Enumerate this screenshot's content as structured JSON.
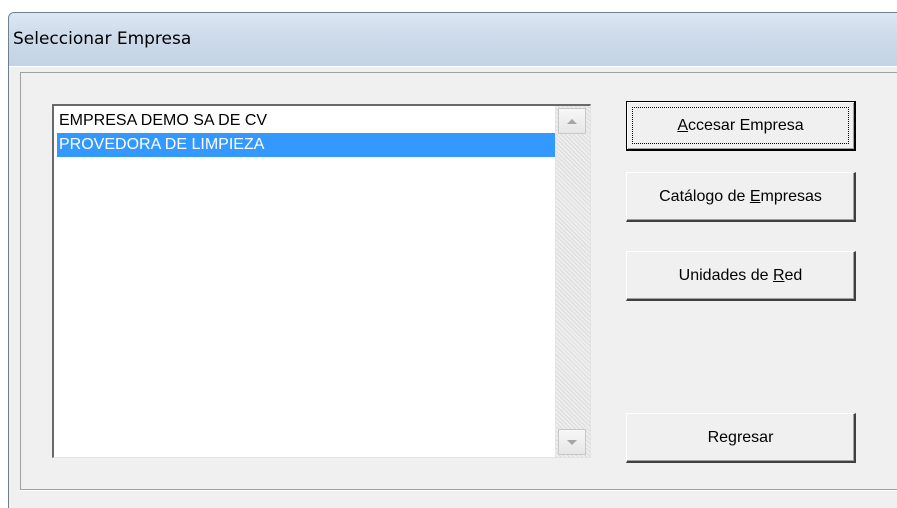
{
  "window": {
    "title": "Seleccionar Empresa"
  },
  "company_list": {
    "items": [
      {
        "label": "EMPRESA DEMO SA DE CV",
        "selected": false
      },
      {
        "label": "PROVEDORA DE LIMPIEZA",
        "selected": true
      }
    ]
  },
  "buttons": {
    "accesar": {
      "pre": "",
      "accel": "A",
      "post": "ccesar Empresa",
      "default": true
    },
    "catalogo": {
      "pre": "Catálogo de ",
      "accel": "E",
      "post": "mpresas"
    },
    "unidades": {
      "pre": "Unidades de ",
      "accel": "R",
      "post": "ed"
    },
    "regresar": {
      "pre": "Regresar",
      "accel": "",
      "post": ""
    }
  },
  "colors": {
    "selection": "#3399ff",
    "titlebar": "#cddbea",
    "dialog_background": "#f0f0f0"
  },
  "icons": {
    "scroll_up": "chevron-up-icon",
    "scroll_down": "chevron-down-icon"
  }
}
